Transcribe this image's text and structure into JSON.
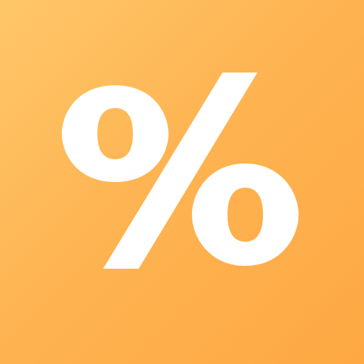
{
  "icon": {
    "name": "percent-icon",
    "symbol": "%",
    "colors": {
      "background_light": "#FFC76A",
      "background_mid": "#FEB452",
      "background_dark": "#FDA843",
      "glyph": "#FFFFFF"
    }
  }
}
